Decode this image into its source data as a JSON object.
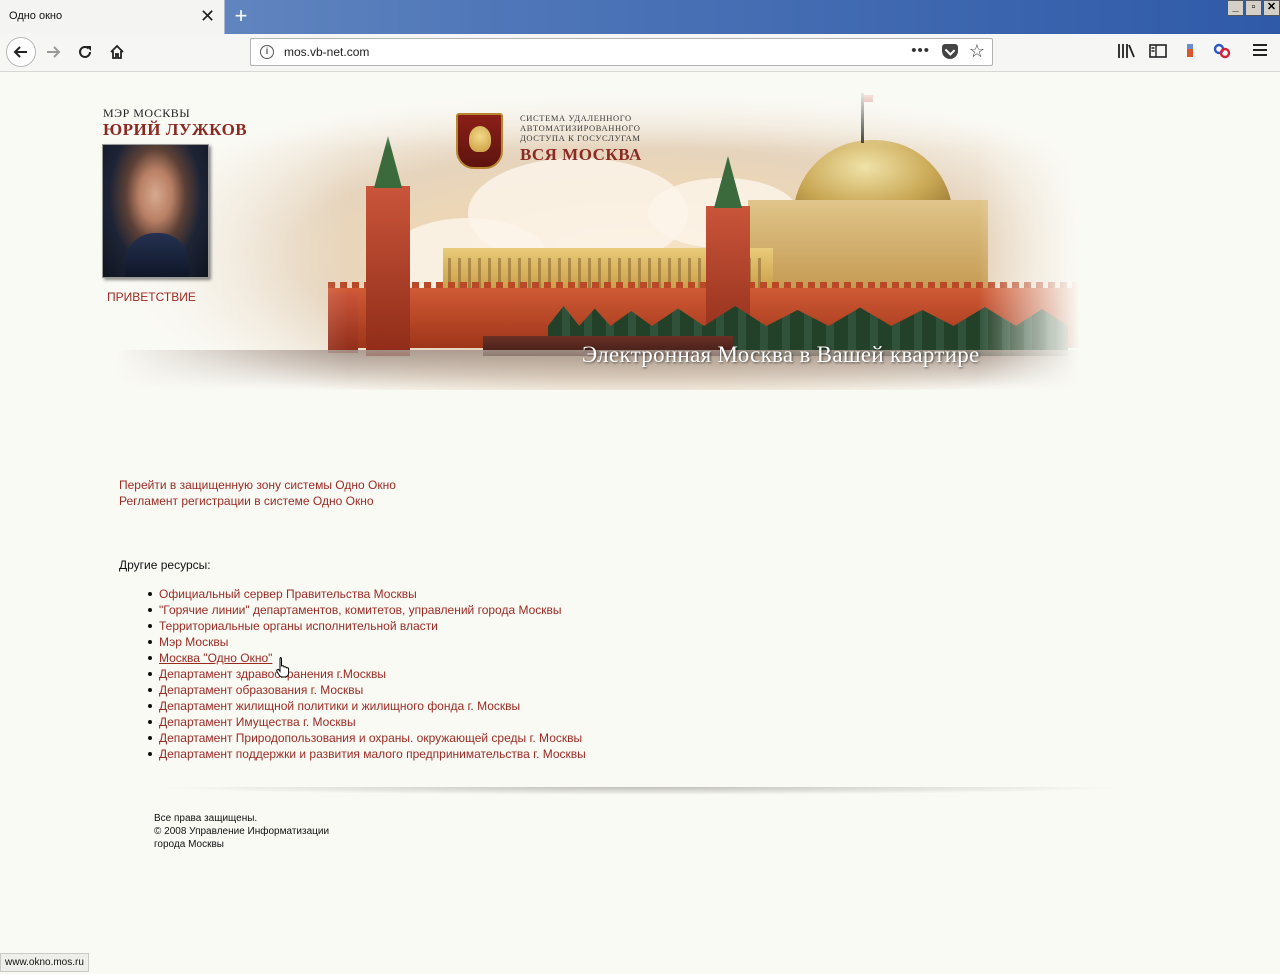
{
  "browser": {
    "tab_title": "Одно окно",
    "tab_close": "✕",
    "new_tab": "+",
    "url": "mos.vb-net.com",
    "win_minimize": "_",
    "win_restore": "▫",
    "win_close": "✕",
    "url_more": "•••",
    "icons": [
      "back-arrow-icon",
      "forward-arrow-icon",
      "reload-icon",
      "home-icon",
      "info-icon",
      "pocket-icon",
      "star-icon",
      "library-icon",
      "sidebar-icon",
      "extension-icon",
      "menu-icon"
    ]
  },
  "header": {
    "mayor_title": "МЭР МОСКВЫ",
    "mayor_name": "ЮРИЙ ЛУЖКОВ",
    "greeting_link": "ПРИВЕТСТВИЕ",
    "system_line1": "СИСТЕМА УДАЛЕННОГО",
    "system_line2": "АВТОМАТИЗИРОВАННОГО",
    "system_line3": "ДОСТУПА К ГОСУСЛУГАМ",
    "system_name": "ВСЯ МОСКВА",
    "tagline": "Электронная Москва в Вашей квартире"
  },
  "main": {
    "links": [
      "Перейти в защищенную зону системы Одно Окно",
      "Регламент регистрации в системе Одно Окно"
    ],
    "other_title": "Другие ресурсы:",
    "resources": [
      "Официальный сервер Правительства Москвы",
      "\"Горячие линии\" департаментов, комитетов, управлений города Москвы",
      "Территориальные органы исполнительной власти",
      "Мэр Москвы",
      "Москва \"Одно Окно\"",
      "Департамент здравоохранения г.Москвы",
      "Департамент образования г. Москвы",
      "Департамент жилищной политики и жилищного фонда г. Москвы",
      "Департамент Имущества г. Москвы",
      "Департамент Природопользования и охраны. окружающей среды г. Москвы",
      "Департамент поддержки и развития малого предпринимательства г. Москвы"
    ]
  },
  "footer": {
    "line1": "Все права защищены.",
    "line2": "© 2008 Управление Информатизации",
    "line3": "города Москвы"
  },
  "status": {
    "url": "www.okno.mos.ru"
  },
  "colors": {
    "link": "#9a2b24",
    "accent": "#8a2a22",
    "page_bg": "#fafaf5"
  }
}
